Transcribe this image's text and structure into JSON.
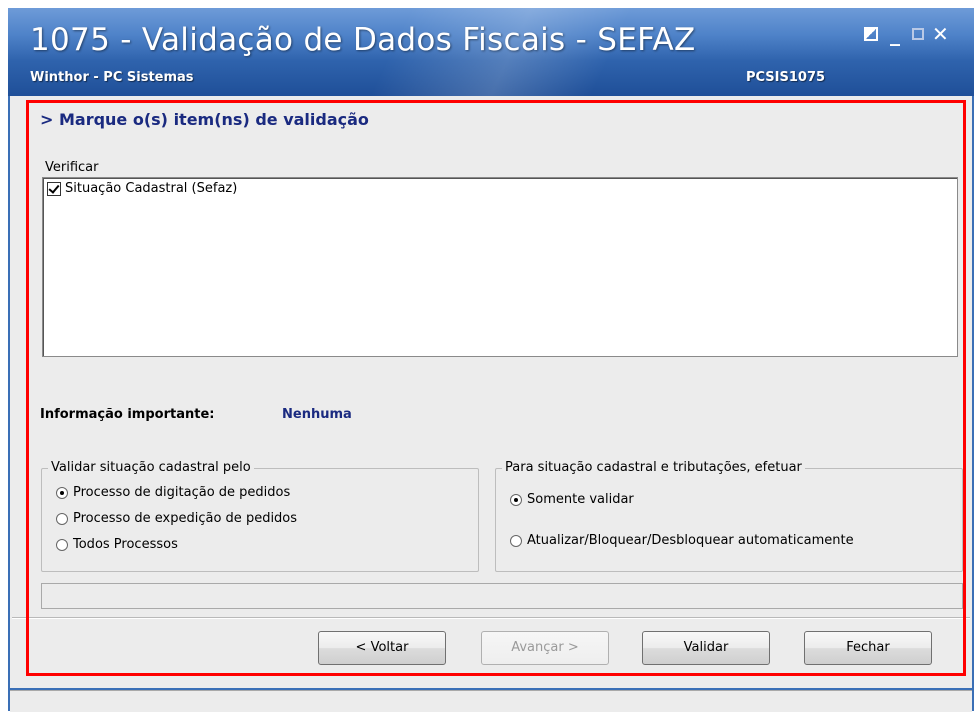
{
  "window": {
    "title": "1075 - Validação de Dados Fiscais - SEFAZ",
    "subtitle": "Winthor - PC Sistemas",
    "code": "PCSIS1075",
    "controls": {
      "min": "_",
      "close": "✕"
    }
  },
  "heading": "> Marque o(s) item(ns) de validação",
  "verificar": {
    "legend": "Verificar",
    "items": [
      {
        "label": "Situação Cadastral (Sefaz)",
        "checked": true
      }
    ]
  },
  "info": {
    "label": "Informação importante:",
    "value": "Nenhuma"
  },
  "validar_group": {
    "legend": "Validar situação cadastral pelo",
    "options": [
      {
        "label": "Processo de digitação de pedidos",
        "selected": true
      },
      {
        "label": "Processo de expedição de pedidos",
        "selected": false
      },
      {
        "label": "Todos Processos",
        "selected": false
      }
    ]
  },
  "efetuar_group": {
    "legend": "Para situação cadastral e tributações, efetuar",
    "options": [
      {
        "label": "Somente validar",
        "selected": true
      },
      {
        "label": "Atualizar/Bloquear/Desbloquear automaticamente",
        "selected": false
      }
    ]
  },
  "buttons": {
    "voltar": "< Voltar",
    "avancar": "Avançar >",
    "validar": "Validar",
    "fechar": "Fechar"
  },
  "colors": {
    "heading": "#1a2a80",
    "highlight": "#ff0000",
    "titlebar": "#2f63ad"
  }
}
